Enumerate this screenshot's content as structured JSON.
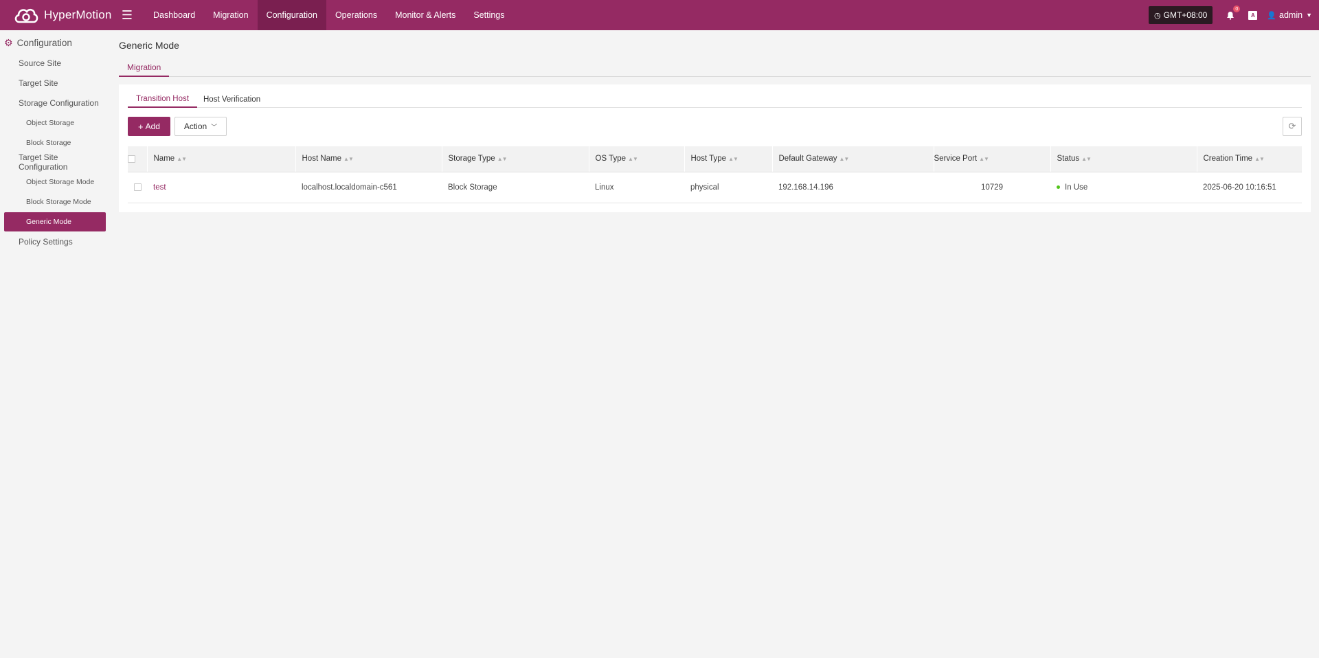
{
  "app": {
    "name": "HyperMotion"
  },
  "topnav": {
    "items": [
      {
        "label": "Dashboard"
      },
      {
        "label": "Migration"
      },
      {
        "label": "Configuration"
      },
      {
        "label": "Operations"
      },
      {
        "label": "Monitor & Alerts"
      },
      {
        "label": "Settings"
      }
    ],
    "active": "Configuration",
    "timezone": "GMT+08:00",
    "notification_count": "0",
    "user": "admin"
  },
  "sidebar": {
    "title": "Configuration",
    "items": [
      {
        "label": "Source Site",
        "level": 1
      },
      {
        "label": "Target Site",
        "level": 1
      },
      {
        "label": "Storage Configuration",
        "level": 1
      },
      {
        "label": "Object Storage",
        "level": 2
      },
      {
        "label": "Block Storage",
        "level": 2
      },
      {
        "label": "Target Site Configuration",
        "level": 1
      },
      {
        "label": "Object Storage Mode",
        "level": 2
      },
      {
        "label": "Block Storage Mode",
        "level": 2
      },
      {
        "label": "Generic Mode",
        "level": 2,
        "active": true
      },
      {
        "label": "Policy Settings",
        "level": 1
      }
    ]
  },
  "main": {
    "title": "Generic Mode",
    "outer_tab": "Migration",
    "inner_tabs": [
      {
        "label": "Transition Host",
        "active": true
      },
      {
        "label": "Host Verification"
      }
    ],
    "toolbar": {
      "add_label": "Add",
      "action_label": "Action"
    },
    "table": {
      "columns": [
        "Name",
        "Host Name",
        "Storage Type",
        "OS Type",
        "Host Type",
        "Default Gateway",
        "Service Port",
        "Status",
        "Creation Time"
      ],
      "rows": [
        {
          "name": "test",
          "host_name": "localhost.localdomain-c561",
          "storage_type": "Block Storage",
          "os_type": "Linux",
          "host_type": "physical",
          "default_gateway": "192.168.14.196",
          "service_port": "10729",
          "status": "In Use",
          "creation_time": "2025-06-20 10:16:51"
        }
      ]
    }
  },
  "colors": {
    "brand": "#952a63",
    "brand_dark": "#7a1f50",
    "status_ok": "#52c41a"
  }
}
